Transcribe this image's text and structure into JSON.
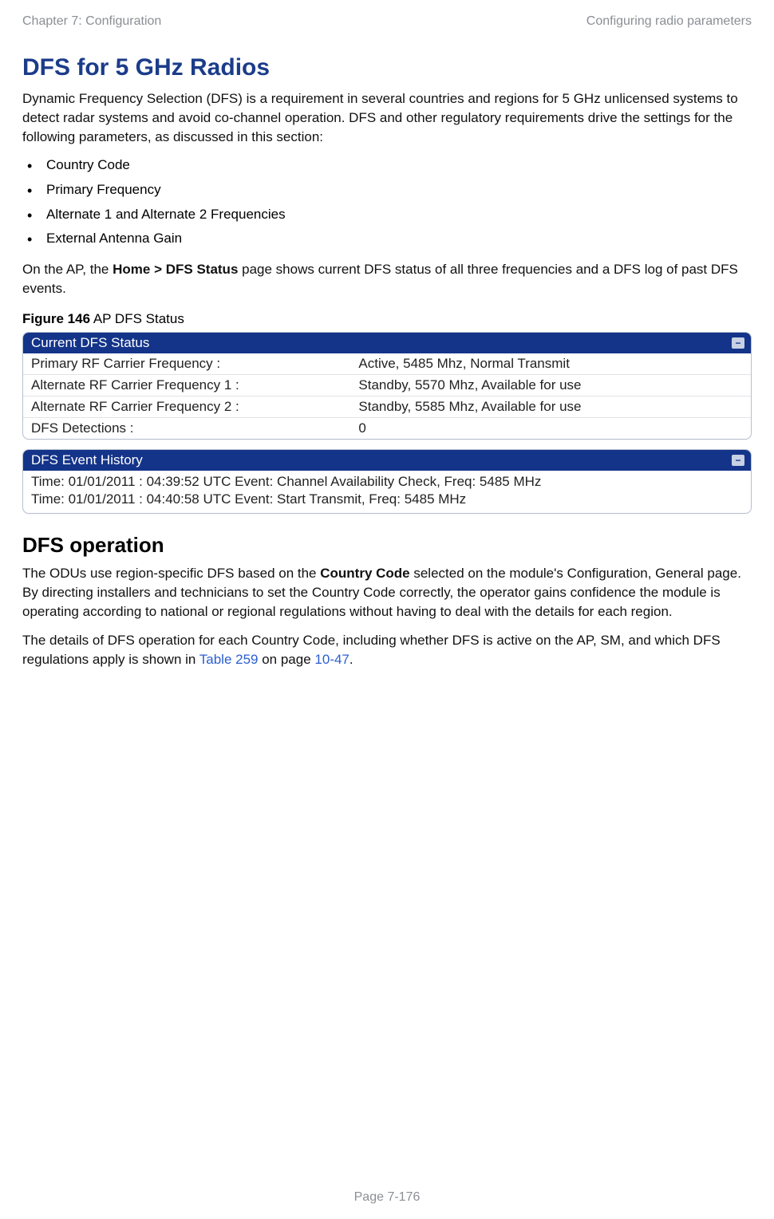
{
  "header": {
    "left": "Chapter 7:  Configuration",
    "right": "Configuring radio parameters"
  },
  "h1": "DFS for 5 GHz Radios",
  "intro": "Dynamic Frequency Selection (DFS) is a requirement in several countries and regions for 5 GHz unlicensed systems to detect radar systems and avoid co-channel operation. DFS and other regulatory requirements drive the settings for the following parameters, as discussed in this section:",
  "bullets": [
    "Country Code",
    "Primary Frequency",
    "Alternate 1 and Alternate 2 Frequencies",
    "External Antenna Gain"
  ],
  "para2_pre": "On the AP, the ",
  "para2_bold": "Home > DFS Status",
  "para2_post": " page shows current DFS status of all three frequencies and a DFS log of past DFS events.",
  "figure": {
    "num": "Figure 146",
    "title": "  AP DFS Status"
  },
  "panel1": {
    "title": "Current DFS Status",
    "rows": [
      {
        "label": "Primary RF Carrier Frequency :",
        "value": "Active, 5485 Mhz, Normal Transmit"
      },
      {
        "label": "Alternate RF Carrier Frequency 1 :",
        "value": "Standby, 5570 Mhz, Available for use"
      },
      {
        "label": "Alternate RF Carrier Frequency 2 :",
        "value": "Standby, 5585 Mhz, Available for use"
      },
      {
        "label": "DFS Detections :",
        "value": "0"
      }
    ]
  },
  "panel2": {
    "title": "DFS Event History",
    "events": [
      "Time: 01/01/2011 : 04:39:52 UTC Event: Channel Availability Check, Freq: 5485 MHz",
      "Time: 01/01/2011 : 04:40:58 UTC Event: Start Transmit, Freq: 5485 MHz"
    ]
  },
  "h2": "DFS operation",
  "op_para_pre": "The ODUs use region-specific DFS based on the ",
  "op_para_bold": "Country Code",
  "op_para_post": " selected on the module's Configuration, General page. By directing installers and technicians to set the Country Code correctly, the operator gains confidence the module is operating according to national or regional regulations without having to deal with the details for each region.",
  "op_para2_a": "The details of DFS operation for each Country Code, including whether DFS is active on the AP, SM, and which DFS regulations apply is shown in ",
  "op_para2_link1": "Table 259",
  "op_para2_b": " on page ",
  "op_para2_link2": "10-47",
  "op_para2_c": ".",
  "footer": "Page 7-176",
  "collapse_glyph": "−"
}
